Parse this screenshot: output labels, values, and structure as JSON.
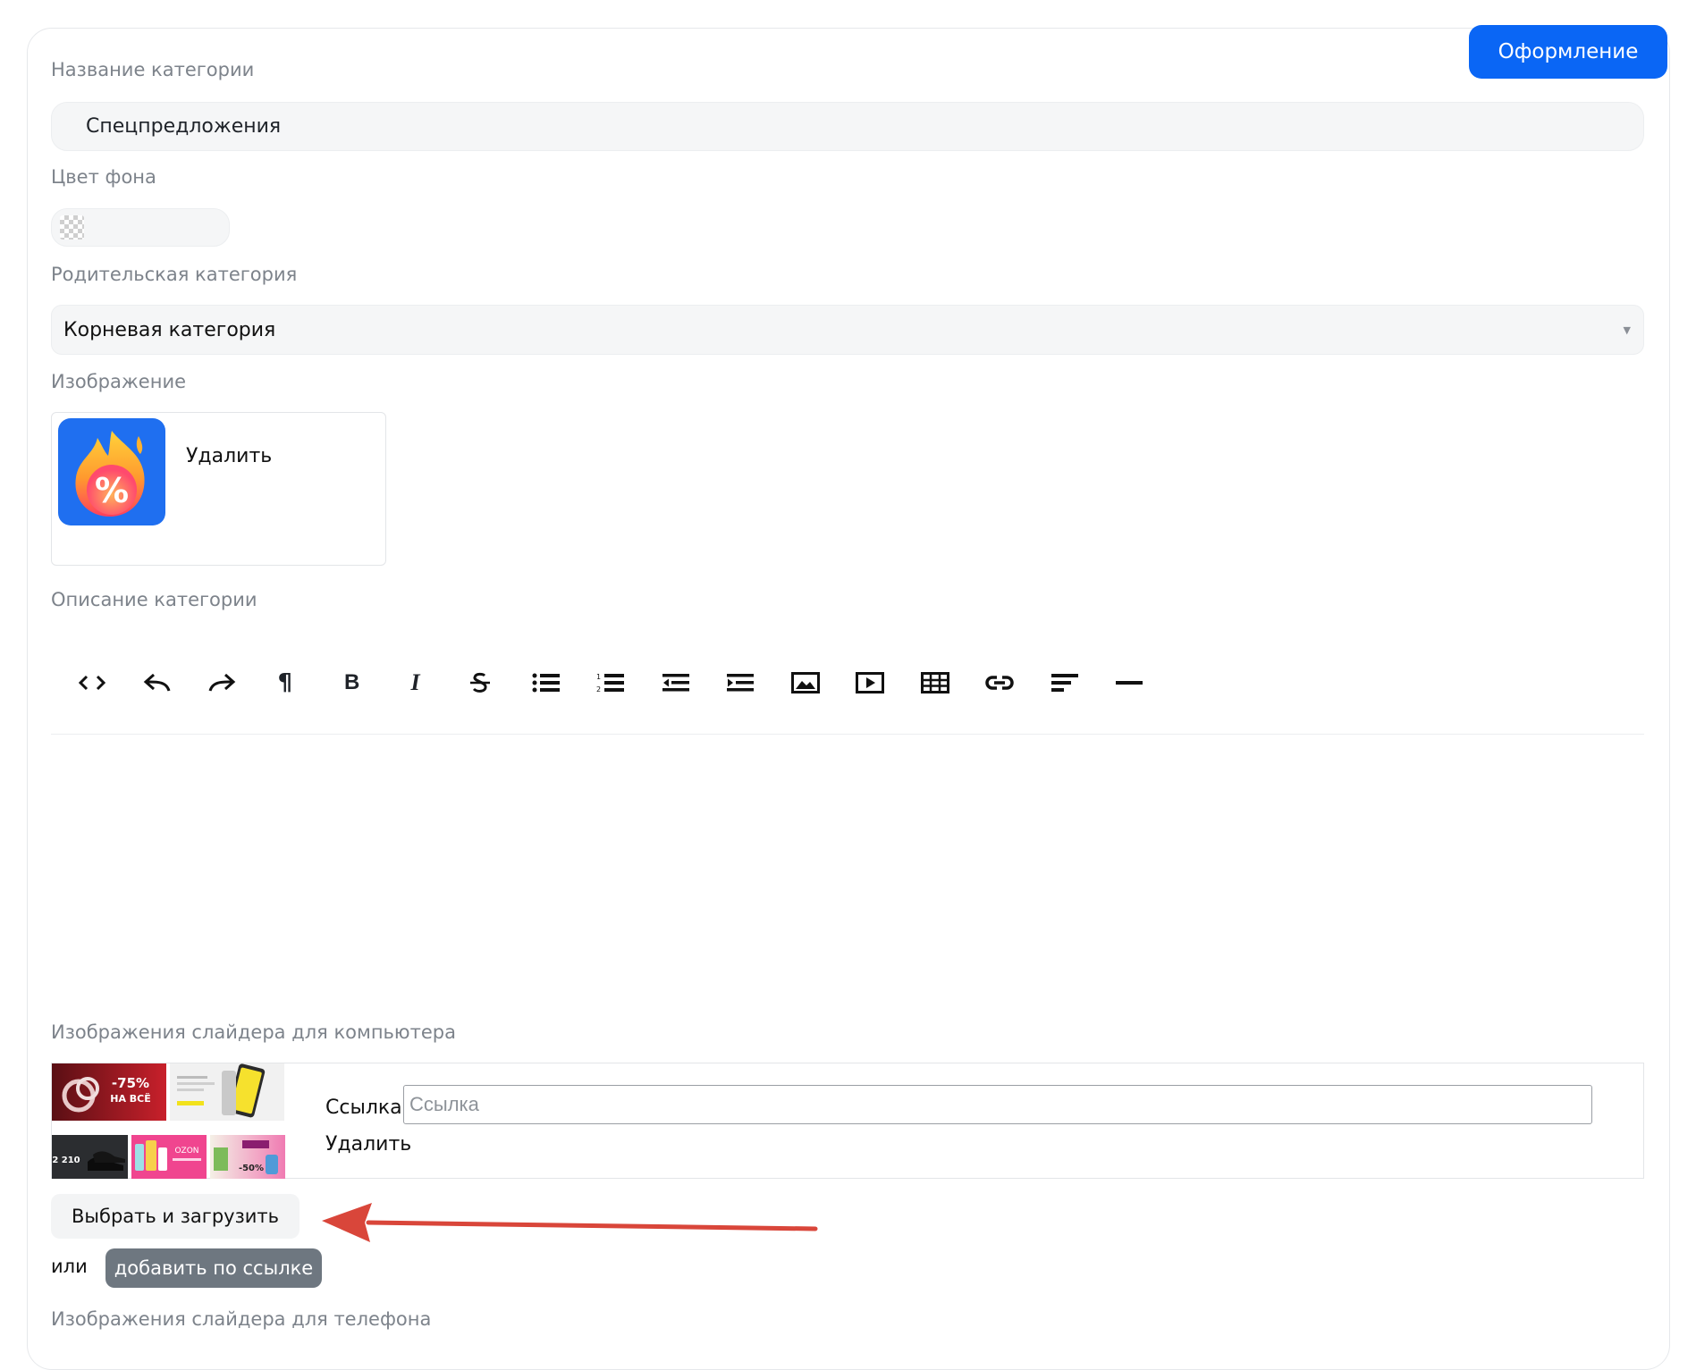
{
  "header": {
    "style_button": "Оформление"
  },
  "fields": {
    "name_label": "Название категории",
    "name_value": "Спецпредложения",
    "color_label": "Цвет фона",
    "parent_label": "Родительская категория",
    "parent_value": "Корневая категория",
    "image_label": "Изображение",
    "image_delete": "Удалить",
    "description_label": "Описание категории"
  },
  "toolbar": {
    "icons": [
      "code-icon",
      "undo-icon",
      "redo-icon",
      "paragraph-icon",
      "bold-icon",
      "italic-icon",
      "strikethrough-icon",
      "bulleted-list-icon",
      "numbered-list-icon",
      "outdent-icon",
      "indent-icon",
      "image-icon",
      "video-icon",
      "table-icon",
      "link-icon",
      "align-icon",
      "horizontal-rule-icon"
    ],
    "bold_glyph": "B",
    "italic_glyph": "I",
    "paragraph_glyph": "¶"
  },
  "slider_desktop": {
    "label": "Изображения слайдера для компьютера",
    "banner_promo_top": "-75%",
    "banner_promo_bottom": "НА ВСЁ",
    "banner_price": "2 210",
    "banner_ozon": "OZON",
    "banner_discount": "-50%",
    "link_label": "Ссылка",
    "link_placeholder": "Ссылка",
    "link_value": "",
    "delete_label": "Удалить"
  },
  "actions": {
    "upload_button": "Выбрать и загрузить",
    "or_text": "или",
    "add_by_link_button": "добавить по ссылке"
  },
  "slider_phone": {
    "label": "Изображения слайдера для телефона"
  },
  "colors": {
    "accent": "#0a66f5",
    "secondary_button": "#6e7780",
    "arrow": "#d9463a",
    "field_bg": "#f5f6f7"
  }
}
